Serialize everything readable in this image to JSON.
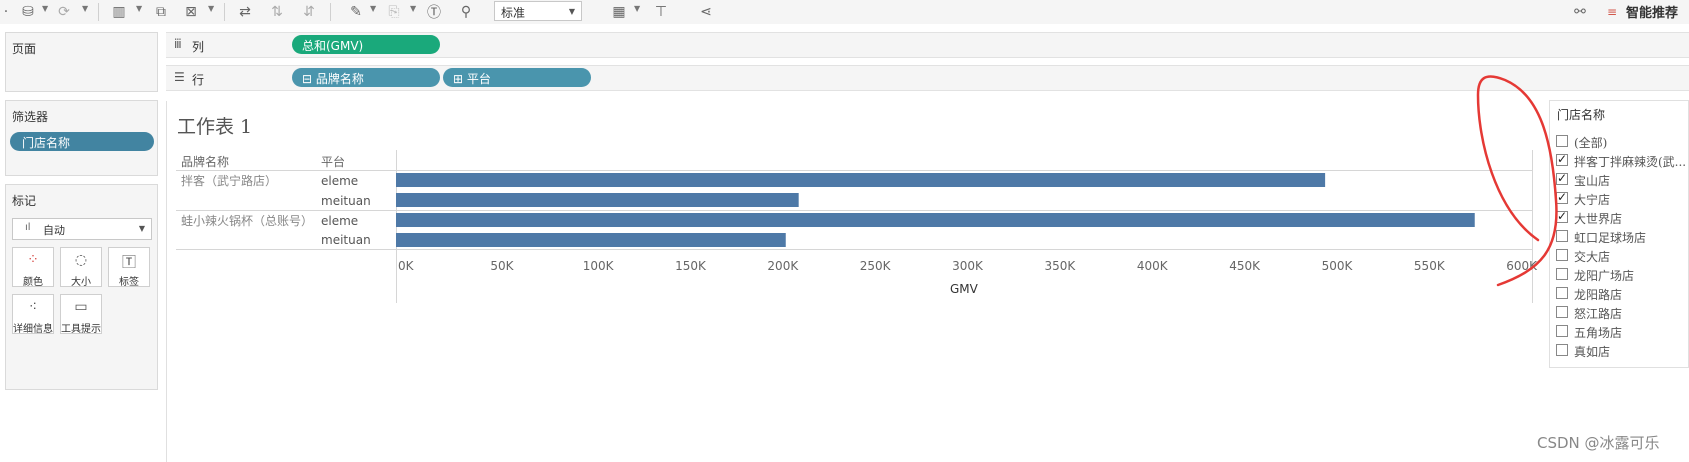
{
  "toolbar": {
    "view_size": "标准",
    "smart_recommend": "智能推荐"
  },
  "left": {
    "pages_title": "页面",
    "filters_title": "筛选器",
    "filter_pill": "门店名称",
    "marks_title": "标记",
    "marks_type": "自动",
    "mark_buttons": [
      "颜色",
      "大小",
      "标签",
      "详细信息",
      "工具提示"
    ]
  },
  "shelves": {
    "columns_label": "列",
    "columns_pill": "总和(GMV)",
    "rows_label": "行",
    "rows_pills": [
      "品牌名称",
      "平台"
    ]
  },
  "sheet": {
    "title": "工作表 1",
    "header_brand": "品牌名称",
    "header_platform": "平台",
    "axis_title": "GMV"
  },
  "chart_data": {
    "type": "bar",
    "orientation": "horizontal",
    "series_color": "#4e79a7",
    "rows": [
      {
        "brand": "拌客（武宁路店）",
        "platform": "eleme",
        "value": 503000
      },
      {
        "brand": "",
        "platform": "meituan",
        "value": 218000
      },
      {
        "brand": "蛙小辣火锅杯（总账号）",
        "platform": "eleme",
        "value": 584000
      },
      {
        "brand": "",
        "platform": "meituan",
        "value": 211000
      }
    ],
    "xlabel": "GMV",
    "xlim": [
      0,
      615000
    ],
    "ticks": [
      0,
      50000,
      100000,
      150000,
      200000,
      250000,
      300000,
      350000,
      400000,
      450000,
      500000,
      550000,
      600000
    ],
    "tick_labels": [
      "0K",
      "50K",
      "100K",
      "150K",
      "200K",
      "250K",
      "300K",
      "350K",
      "400K",
      "450K",
      "500K",
      "550K",
      "600K"
    ]
  },
  "legend": {
    "title": "门店名称",
    "items": [
      {
        "label": "(全部)",
        "checked": false
      },
      {
        "label": "拌客丁拌麻辣烫(武...",
        "checked": true
      },
      {
        "label": "宝山店",
        "checked": true
      },
      {
        "label": "大宁店",
        "checked": true
      },
      {
        "label": "大世界店",
        "checked": true
      },
      {
        "label": "虹口足球场店",
        "checked": false
      },
      {
        "label": "交大店",
        "checked": false
      },
      {
        "label": "龙阳广场店",
        "checked": false
      },
      {
        "label": "龙阳路店",
        "checked": false
      },
      {
        "label": "怒江路店",
        "checked": false
      },
      {
        "label": "五角场店",
        "checked": false
      },
      {
        "label": "真如店",
        "checked": false
      }
    ]
  },
  "watermark": "CSDN @冰露可乐",
  "colors": {
    "columns_pill": "#1aa97b",
    "rows_pill": "#4a95ad",
    "bar": "#4e79a7",
    "annotation": "#e53935"
  }
}
